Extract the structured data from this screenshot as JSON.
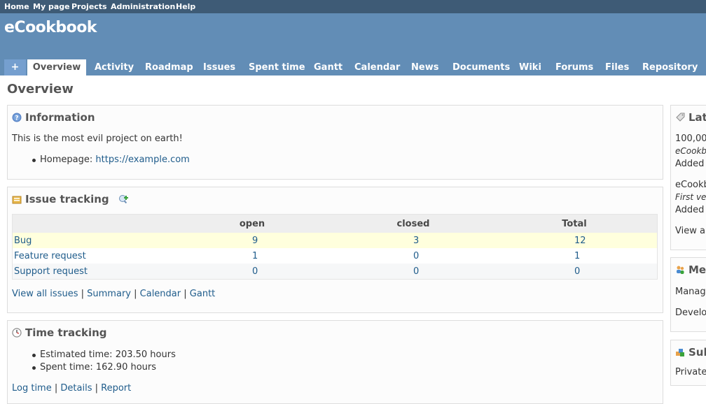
{
  "top_menu": [
    "Home",
    "My page",
    "Projects",
    "Administration",
    "Help"
  ],
  "project_title": "eCookbook",
  "tabs": {
    "plus": "+",
    "items": [
      "Overview",
      "Activity",
      "Roadmap",
      "Issues",
      "Spent time",
      "Gantt",
      "Calendar",
      "News",
      "Documents",
      "Wiki",
      "Forums",
      "Files",
      "Repository"
    ]
  },
  "page_title": "Overview",
  "information": {
    "title": "Information",
    "description": "This is the most evil project on earth!",
    "homepage_label": "Homepage:",
    "homepage_url": "https://example.com"
  },
  "issue_tracking": {
    "title": "Issue tracking",
    "columns": [
      "open",
      "closed",
      "Total"
    ],
    "rows": [
      {
        "tracker": "Bug",
        "open": "9",
        "closed": "3",
        "total": "12"
      },
      {
        "tracker": "Feature request",
        "open": "1",
        "closed": "0",
        "total": "1"
      },
      {
        "tracker": "Support request",
        "open": "0",
        "closed": "0",
        "total": "0"
      }
    ],
    "links": [
      "View all issues",
      "Summary",
      "Calendar",
      "Gantt"
    ]
  },
  "time_tracking": {
    "title": "Time tracking",
    "estimated": "Estimated time: 203.50 hours",
    "spent": "Spent time: 162.90 hours",
    "links": [
      "Log time",
      "Details",
      "Report"
    ]
  },
  "sidebar": {
    "news": {
      "title": "Lat",
      "items": [
        {
          "link": "100,00",
          "meta": "eCookb",
          "added": "Added"
        },
        {
          "link": "eCookb",
          "meta": "First ve",
          "added": "Added"
        }
      ],
      "view_all": "View al"
    },
    "members": {
      "title": "Mem",
      "roles": [
        "Manage",
        "Develo"
      ]
    },
    "subprojects": {
      "title": "Sub",
      "items": [
        "Private"
      ]
    }
  },
  "colors": {
    "top_bar": "#3e5b76",
    "header": "#628db6",
    "link": "#1f5c8b",
    "odd_row": "#ffffdd"
  }
}
